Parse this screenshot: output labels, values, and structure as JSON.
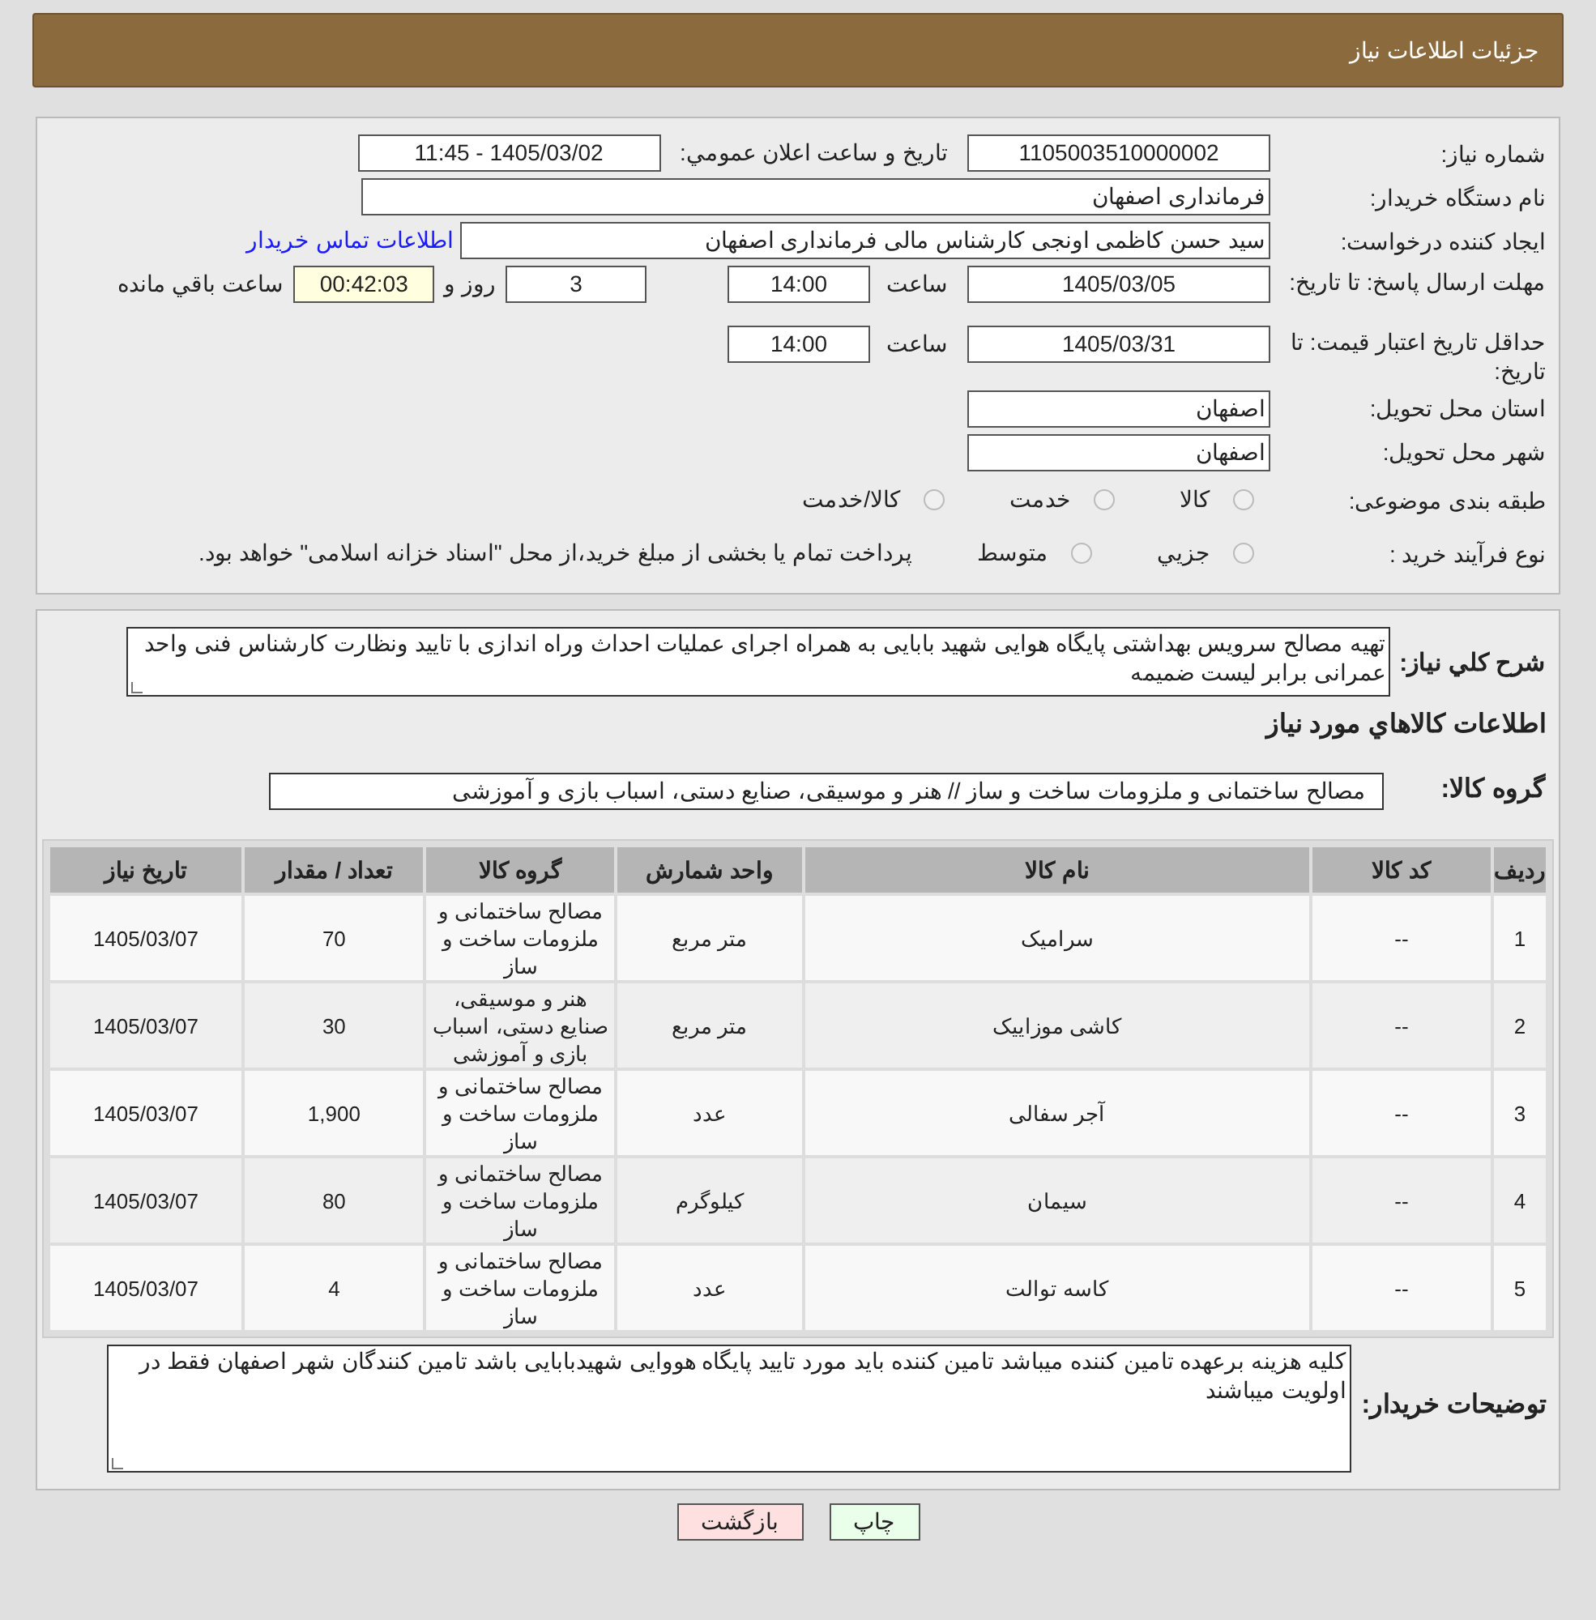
{
  "header": {
    "title": "جزئیات اطلاعات نیاز"
  },
  "form": {
    "need_number": {
      "label": "شماره نیاز:",
      "value": "1105003510000002"
    },
    "announce": {
      "label": "تاریخ و ساعت اعلان عمومي:",
      "value": "1405/03/02 - 11:45"
    },
    "buyer": {
      "label": "نام دستگاه خریدار:",
      "value": "فرمانداری اصفهان"
    },
    "requester": {
      "label": "ایجاد کننده درخواست:",
      "value": "سید حسن  کاظمی اونجی کارشناس مالی  فرمانداری اصفهان",
      "link": "اطلاعات تماس خریدار"
    },
    "deadline": {
      "label": "مهلت ارسال پاسخ: تا تاریخ:",
      "date": "1405/03/05",
      "time_label": "ساعت",
      "time": "14:00",
      "days": "3",
      "days_label": "روز و",
      "remaining": "00:42:03",
      "remaining_label": "ساعت باقي مانده"
    },
    "validity": {
      "label": "حداقل تاریخ اعتبار قیمت: تا تاریخ:",
      "date": "1405/03/31",
      "time_label": "ساعت",
      "time": "14:00"
    },
    "province": {
      "label": "استان محل تحویل:",
      "value": "اصفهان"
    },
    "city": {
      "label": "شهر محل تحویل:",
      "value": "اصفهان"
    },
    "category": {
      "label": "طبقه بندی موضوعی:",
      "options": [
        {
          "label": "كالا",
          "selected": false
        },
        {
          "label": "خدمت",
          "selected": false
        },
        {
          "label": "كالا/خدمت",
          "selected": false
        }
      ]
    },
    "process": {
      "label": "نوع فرآیند خرید :",
      "options": [
        {
          "label": "جزيي",
          "selected": false
        },
        {
          "label": "متوسط",
          "selected": false
        }
      ],
      "note": "پرداخت تمام یا بخشی از مبلغ خرید،از محل \"اسناد خزانه اسلامی\" خواهد بود."
    }
  },
  "summary": {
    "label": "شرح كلي نياز:",
    "value": "تهیه مصالح سرویس بهداشتی پایگاه هوایی شهید بابایی به همراه اجرای عملیات احداث وراه اندازی با تایید ونظارت کارشناس فنی واحد عمرانی برابر لیست ضمیمه"
  },
  "goods_title": "اطلاعات كالاهاي مورد نياز",
  "goods_group": {
    "label": "گروه کالا:",
    "value": "مصالح ساختمانی و ملزومات ساخت و ساز // هنر و موسیقی، صنایع دستی، اسباب بازی و آموزشی"
  },
  "table": {
    "columns": [
      "ردیف",
      "کد کالا",
      "نام کالا",
      "واحد شمارش",
      "گروه کالا",
      "تعداد / مقدار",
      "تاریخ نیاز"
    ],
    "rows": [
      [
        "1",
        "--",
        "سرامیک",
        "متر مربع",
        "مصالح ساختمانی و ملزومات ساخت و ساز",
        "70",
        "1405/03/07"
      ],
      [
        "2",
        "--",
        "کاشی موزاییک",
        "متر مربع",
        "هنر و موسیقی، صنایع دستی، اسباب بازی و آموزشی",
        "30",
        "1405/03/07"
      ],
      [
        "3",
        "--",
        "آجر سفالی",
        "عدد",
        "مصالح ساختمانی و ملزومات ساخت و ساز",
        "1,900",
        "1405/03/07"
      ],
      [
        "4",
        "--",
        "سیمان",
        "کیلوگرم",
        "مصالح ساختمانی و ملزومات ساخت و ساز",
        "80",
        "1405/03/07"
      ],
      [
        "5",
        "--",
        "کاسه توالت",
        "عدد",
        "مصالح ساختمانی و ملزومات ساخت و ساز",
        "4",
        "1405/03/07"
      ]
    ]
  },
  "buyer_notes": {
    "label": "توضیحات خریدار:",
    "value": "کلیه هزینه برعهده تامین کننده میباشد تامین کننده باید  مورد تایید پایگاه هووایی شهیدبابایی باشد تامین کنندگان شهر اصفهان فقط در اولویت میباشند"
  },
  "buttons": [
    {
      "kind": "print",
      "label": "چاپ"
    },
    {
      "kind": "back",
      "label": "بازگشت"
    }
  ]
}
